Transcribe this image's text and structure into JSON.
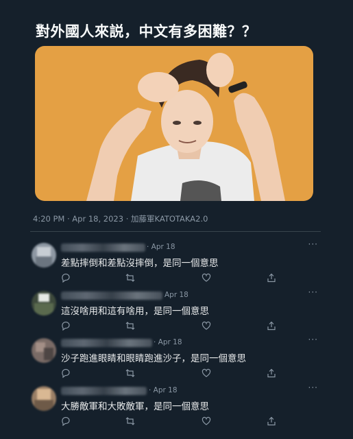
{
  "tweet": {
    "title": "對外國人來説，中文有多困難？？",
    "meta": "4:20 PM · Apr 18, 2023 · 加藤軍KATOTAKA2.0"
  },
  "replies": [
    {
      "date": "· Apr 18",
      "text": "差點摔倒和差點沒摔倒，是同一個意思",
      "more": "···"
    },
    {
      "date": "Apr 18",
      "text": "這沒啥用和這有啥用，是同一個意思",
      "more": "···"
    },
    {
      "date": "· Apr 18",
      "text": "沙子跑進眼睛和眼睛跑進沙子，是同一個意思",
      "more": "···"
    },
    {
      "date": "· Apr 18",
      "text": "大勝敵軍和大敗敵軍，是同一個意思",
      "more": "···"
    }
  ],
  "icons": [
    "reply-icon",
    "retweet-icon",
    "like-icon",
    "share-icon",
    "more-icon"
  ],
  "colors": {
    "background": "#15202b",
    "muted": "#8b98a5",
    "text": "#e7e9ea",
    "photo_bg": "#e8a64a"
  }
}
